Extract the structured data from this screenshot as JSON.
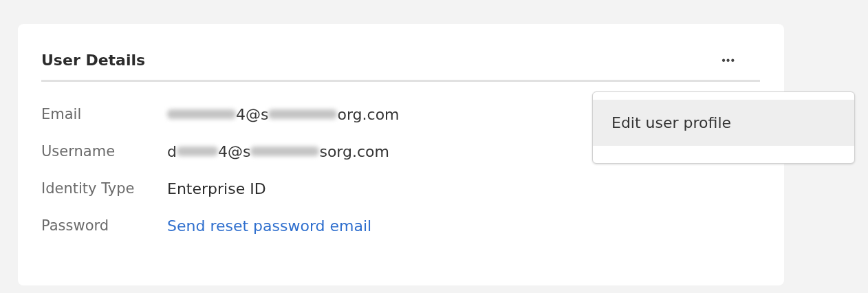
{
  "card": {
    "title": "User Details",
    "more_button": "•••",
    "fields": [
      {
        "label": "Email",
        "kind": "segments",
        "segments": [
          {
            "kind": "redacted-long"
          },
          {
            "kind": "text",
            "text": "4@s"
          },
          {
            "kind": "redacted-long"
          },
          {
            "kind": "text",
            "text": "org.com"
          }
        ]
      },
      {
        "label": "Username",
        "kind": "segments",
        "segments": [
          {
            "kind": "text",
            "text": "d"
          },
          {
            "kind": "redacted-short"
          },
          {
            "kind": "text",
            "text": "4@s"
          },
          {
            "kind": "redacted-long"
          },
          {
            "kind": "text",
            "text": "sorg.com"
          }
        ]
      },
      {
        "label": "Identity Type",
        "kind": "text",
        "value": "Enterprise ID"
      },
      {
        "label": "Password",
        "kind": "link",
        "value": "Send reset password email"
      }
    ]
  },
  "menu": {
    "items": [
      {
        "label": "Edit user profile",
        "selected": true
      }
    ]
  }
}
